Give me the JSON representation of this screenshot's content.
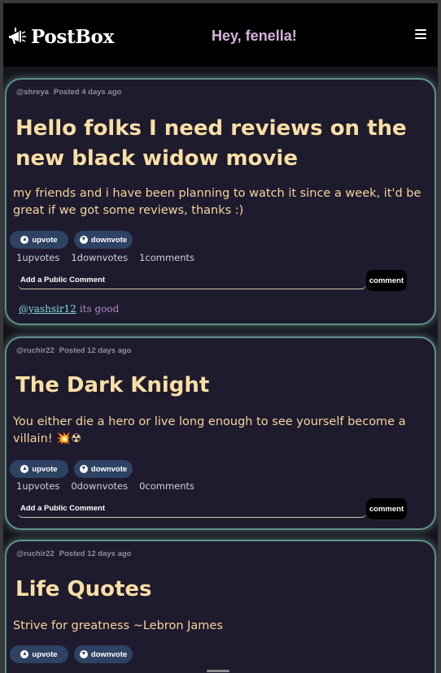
{
  "header": {
    "brand": "PostBox",
    "greeting": "Hey, fenella!",
    "logo_icon": "megaphone-logo-icon",
    "menu_icon": "hamburger-menu-icon"
  },
  "posts": [
    {
      "author": "@shreya",
      "posted": "Posted 4 days ago",
      "title": "Hello folks I need reviews on the new black widow movie",
      "body": "my friends and i have been planning to watch it since a week, it'd be great if we got some reviews, thanks :)",
      "upvote_label": "upvote",
      "downvote_label": "downvote",
      "upvotes": "1upvotes",
      "downvotes": "1downvotes",
      "comments": "1comments",
      "comment_placeholder": "Add a Public Comment",
      "comment_button": "comment",
      "comment_list": [
        {
          "user": "@yashsir12",
          "text": "its good"
        }
      ]
    },
    {
      "author": "@ruchir22",
      "posted": "Posted 12 days ago",
      "title": "The Dark Knight",
      "body": "You either die a hero or live long enough to see yourself become a villain! 💥☢",
      "upvote_label": "upvote",
      "downvote_label": "downvote",
      "upvotes": "1upvotes",
      "downvotes": "0downvotes",
      "comments": "0comments",
      "comment_placeholder": "Add a Public Comment",
      "comment_button": "comment"
    },
    {
      "author": "@ruchir22",
      "posted": "Posted 12 days ago",
      "title": "Life Quotes",
      "body": "Strive for greatness ~Lebron James",
      "upvote_label": "upvote",
      "downvote_label": "downvote"
    }
  ],
  "colors": {
    "card_bg": "#1f1b2e",
    "card_border": "#5f8f8a",
    "title": "#f9dfa5",
    "greeting": "#d7b2dc",
    "vote_button": "#2e4263",
    "comment_user": "#7fd8e0",
    "comment_text": "#b48cc2"
  }
}
